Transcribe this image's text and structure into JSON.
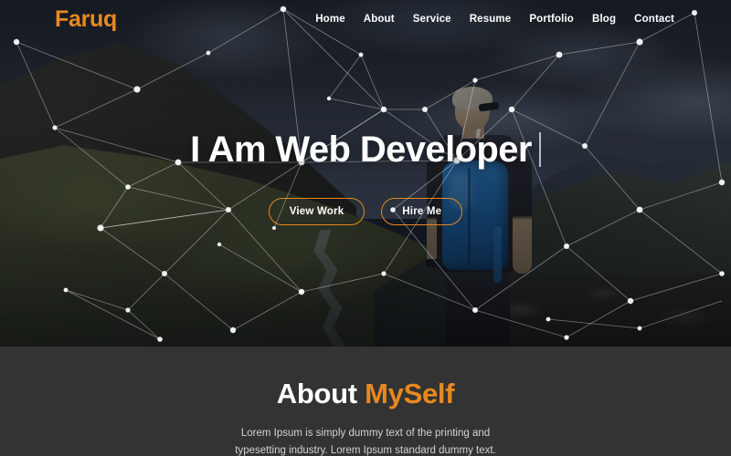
{
  "header": {
    "logo": "Faruq",
    "nav": [
      {
        "label": "Home"
      },
      {
        "label": "About"
      },
      {
        "label": "Service"
      },
      {
        "label": "Resume"
      },
      {
        "label": "Portfolio"
      },
      {
        "label": "Blog"
      },
      {
        "label": "Contact"
      }
    ]
  },
  "hero": {
    "title": "I Am Web Developer",
    "buttons": {
      "primary": "View Work",
      "secondary": "Hire Me"
    }
  },
  "about": {
    "title_white": "About ",
    "title_accent": "MySelf",
    "paragraph": "Lorem Ipsum is simply dummy text of the printing and typesetting industry. Lorem Ipsum standard dummy text."
  },
  "colors": {
    "accent": "#e8891f",
    "about_bg": "#333333",
    "text_light": "#ffffff",
    "body_text": "#d6d3cf"
  }
}
